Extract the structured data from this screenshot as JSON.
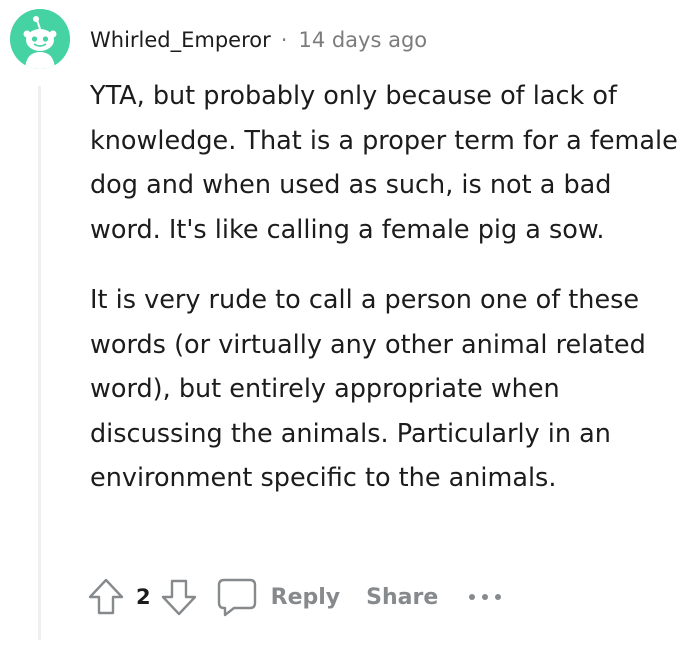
{
  "comment": {
    "username": "Whirled_Emperor",
    "separator": "·",
    "timestamp": "14 days ago",
    "paragraphs": [
      "YTA, but probably only because of lack of knowledge. That is a proper term for a female dog and when used as such, is not a bad word. It's like calling a female pig a sow.",
      "It is very rude to call a person one of these words (or virtually any other animal related word), but entirely appropriate when discussing the animals. Particularly in an environment specific to the animals."
    ],
    "avatar_icon": "snoo-avatar-icon",
    "avatar_color": "#46d3a4"
  },
  "actions": {
    "upvote_icon": "arrow-up-icon",
    "vote_count": "2",
    "downvote_icon": "arrow-down-icon",
    "reply_icon": "speech-bubble-icon",
    "reply_label": "Reply",
    "share_label": "Share",
    "more_icon": "ellipsis-icon"
  }
}
